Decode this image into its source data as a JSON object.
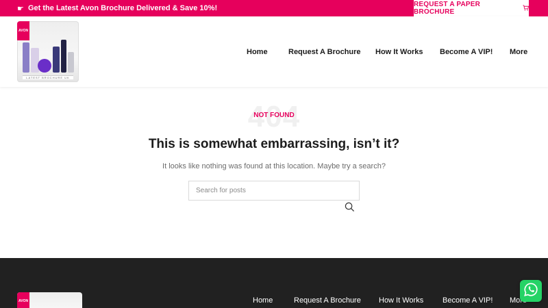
{
  "topbar": {
    "promo_icon": "pointing-hand-icon",
    "promo_text": "Get the Latest Avon Brochure Delivered & Save 10%!",
    "paper_button": "REQUEST A PAPER BROCHURE",
    "paper_button_icon": "cart-icon"
  },
  "header": {
    "logo_brand": "AVON",
    "logo_caption": "LATEST BROCHURE UK",
    "nav": [
      "Home",
      "Request A Brochure",
      "How It Works",
      "Become A VIP!",
      "More"
    ]
  },
  "main": {
    "code": "404",
    "label": "NOT FOUND",
    "headline": "This is somewhat embarrassing, isn’t it?",
    "subtext": "It looks like nothing was found at this location. Maybe try a search?",
    "search_placeholder": "Search for posts",
    "search_icon": "search-icon"
  },
  "footer": {
    "logo_brand": "AVON",
    "nav": [
      "Home",
      "Request A Brochure",
      "How It Works",
      "Become A VIP!",
      "More"
    ]
  },
  "floating": {
    "whatsapp_icon": "whatsapp-icon"
  },
  "colors": {
    "accent": "#e6005c",
    "footer_bg": "#212121",
    "whatsapp": "#25d366"
  }
}
